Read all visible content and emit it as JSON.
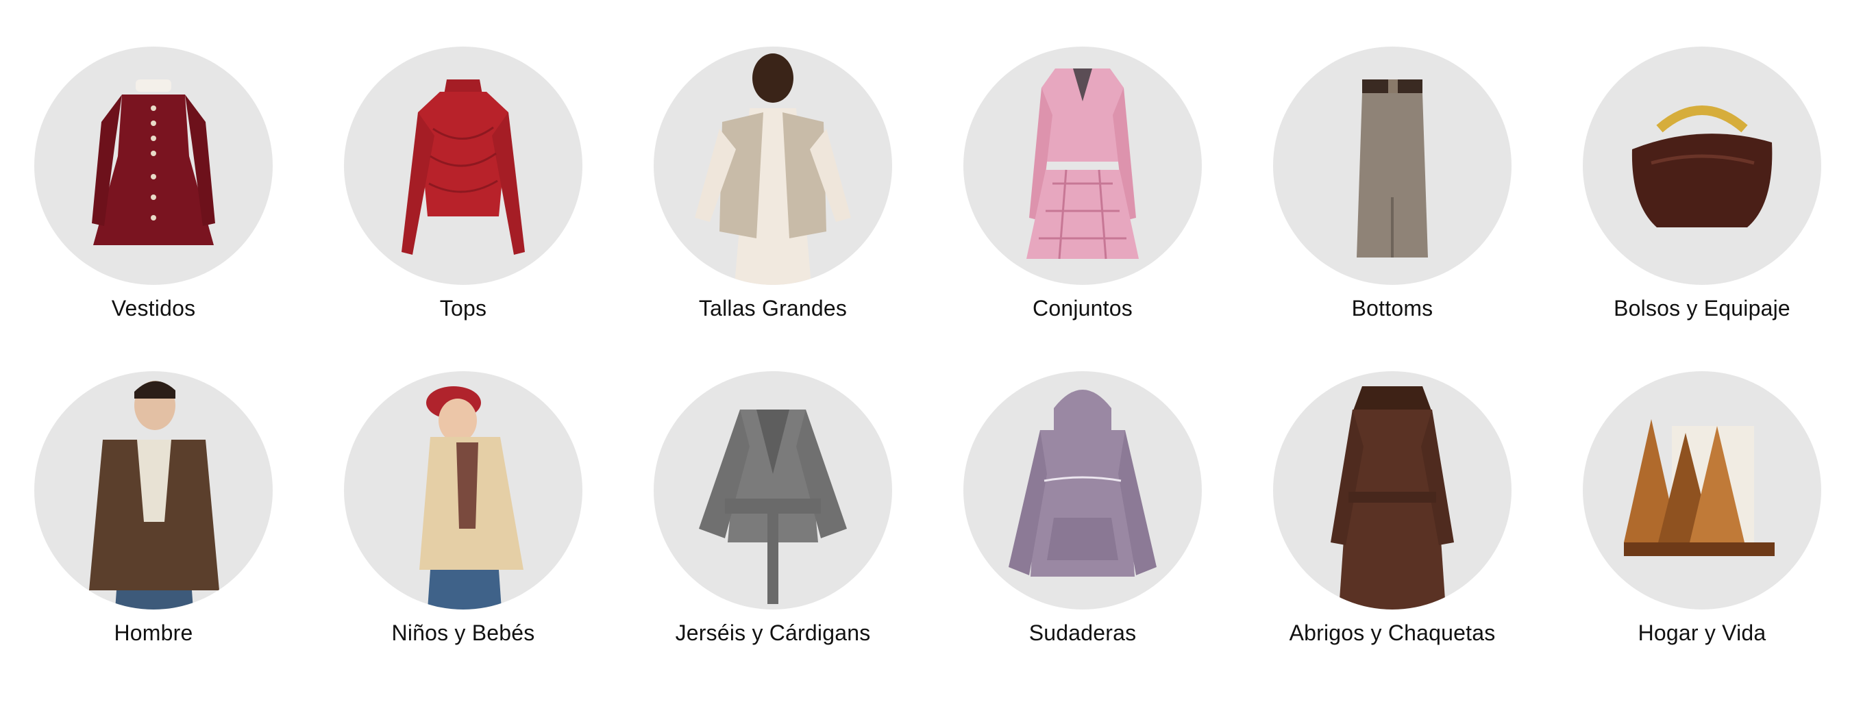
{
  "categories": [
    {
      "label": "Vestidos",
      "icon": "dress-icon"
    },
    {
      "label": "Tops",
      "icon": "top-icon"
    },
    {
      "label": "Tallas Grandes",
      "icon": "plus-size-model-icon"
    },
    {
      "label": "Conjuntos",
      "icon": "co-ord-set-icon"
    },
    {
      "label": "Bottoms",
      "icon": "skirt-icon"
    },
    {
      "label": "Bolsos y Equipaje",
      "icon": "handbag-icon"
    },
    {
      "label": "Hombre",
      "icon": "men-jacket-model-icon"
    },
    {
      "label": "Niños y Bebés",
      "icon": "kid-model-icon"
    },
    {
      "label": "Jerséis y Cárdigans",
      "icon": "cardigan-icon"
    },
    {
      "label": "Sudaderas",
      "icon": "hoodie-icon"
    },
    {
      "label": "Abrigos y Chaquetas",
      "icon": "coat-icon"
    },
    {
      "label": "Hogar y Vida",
      "icon": "home-decor-icon"
    }
  ],
  "colors": {
    "circle_bg": "#e6e6e6",
    "dress": "#7a1420",
    "top": "#b8222a",
    "fur": "#c8bba8",
    "tweed": "#e7a7bf",
    "skirt": "#8f8377",
    "bag": "#4a1f17",
    "bag_handle": "#d6ad3b",
    "leather": "#5b3f2c",
    "puffer": "#e5cfa6",
    "cardigan": "#7b7b7b",
    "hoodie": "#9a88a3",
    "coat": "#5a3224",
    "wood": "#b06a2c"
  }
}
